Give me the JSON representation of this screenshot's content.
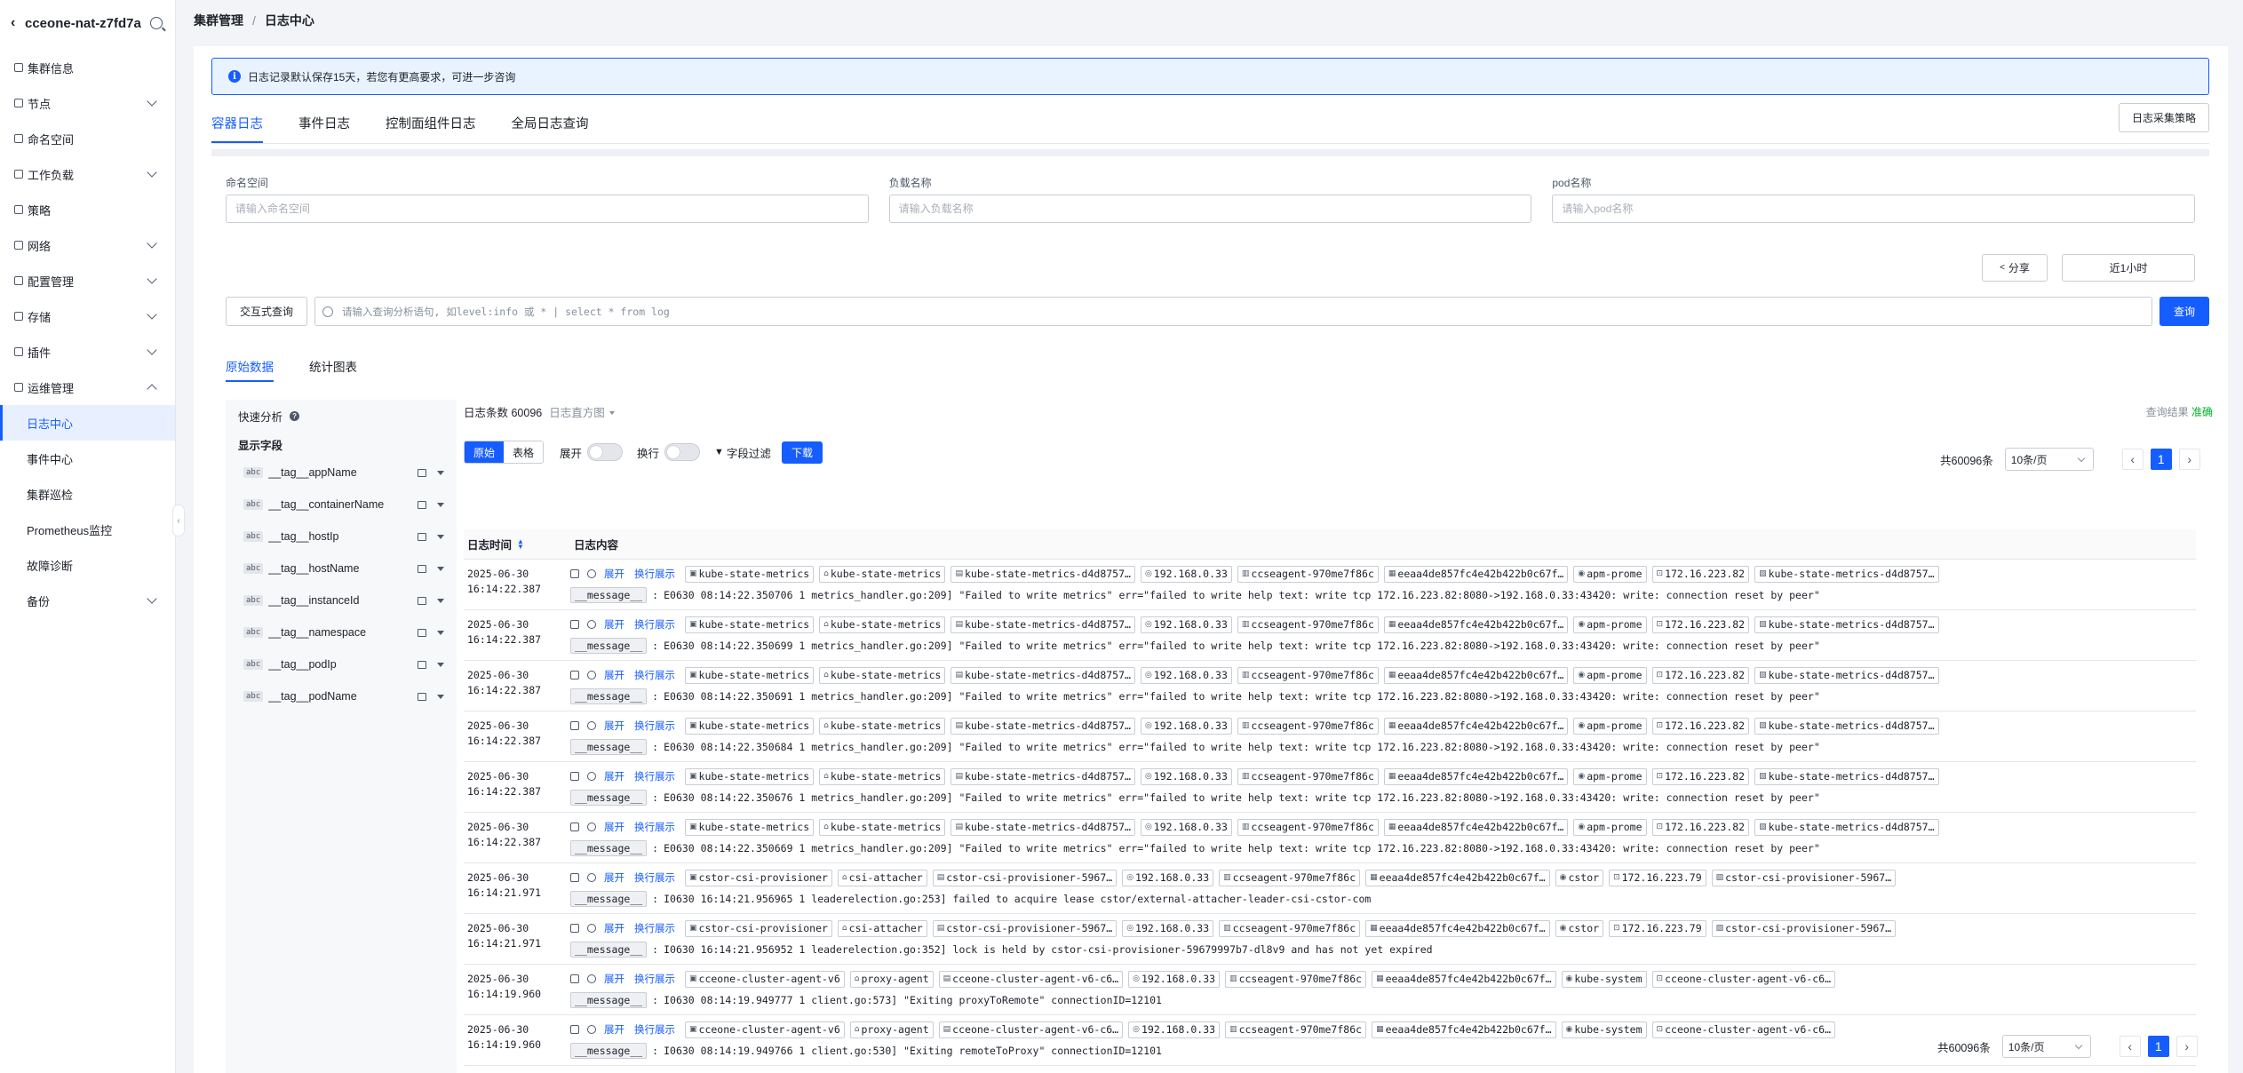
{
  "sidebar": {
    "title": "cceone-nat-z7fd7a",
    "items": [
      {
        "label": "集群信息",
        "chevron": false
      },
      {
        "label": "节点",
        "chevron": true
      },
      {
        "label": "命名空间",
        "chevron": false
      },
      {
        "label": "工作负载",
        "chevron": true
      },
      {
        "label": "策略",
        "chevron": false
      },
      {
        "label": "网络",
        "chevron": true
      },
      {
        "label": "配置管理",
        "chevron": true
      },
      {
        "label": "存储",
        "chevron": true
      },
      {
        "label": "插件",
        "chevron": true
      },
      {
        "label": "运维管理",
        "chevron": true
      }
    ],
    "sub_items": [
      "日志中心",
      "事件中心",
      "集群巡检",
      "Prometheus监控",
      "故障诊断"
    ],
    "last_item": "备份"
  },
  "breadcrumb": {
    "parent": "集群管理",
    "separator": "/",
    "current": "日志中心"
  },
  "notice": {
    "text": "日志记录默认保存15天，若您有更高要求，可进一步咨询"
  },
  "tabs": [
    "容器日志",
    "事件日志",
    "控制面组件日志",
    "全局日志查询"
  ],
  "policy_button": "日志采集策略",
  "filters": [
    {
      "label": "命名空间",
      "placeholder": "请输入命名空间"
    },
    {
      "label": "负载名称",
      "placeholder": "请输入负载名称"
    },
    {
      "label": "pod名称",
      "placeholder": "请输入pod名称"
    }
  ],
  "share_button": "分享",
  "time_button": "近1小时",
  "interactive_button": "交互式查询",
  "query": {
    "placeholder": "请输入查询分析语句, 如level:info 或 * | select * from log",
    "button": "查询"
  },
  "sub_tabs": [
    "原始数据",
    "统计图表"
  ],
  "fields_panel": {
    "quick_analysis": "快速分析",
    "help_icon": "?",
    "display_fields": "显示字段",
    "type_badge": "abc",
    "fields": [
      "__tag__appName",
      "__tag__containerName",
      "__tag__hostIp",
      "__tag__hostName",
      "__tag__instanceId",
      "__tag__namespace",
      "__tag__podIp",
      "__tag__podName"
    ]
  },
  "results": {
    "count_label": "日志条数 60096",
    "histogram": "日志直方图",
    "status_label": "查询结果",
    "status_value": "准确",
    "view_modes": [
      "原始",
      "表格"
    ],
    "expand_label": "展开",
    "wrap_label": "换行",
    "field_filter": "字段过滤",
    "download": "下载",
    "col_time": "日志时间",
    "col_content": "日志内容",
    "row_expand": "展开",
    "row_wrap": "换行展示",
    "message_key": "__message__",
    "key_separator": ":",
    "rows": [
      {
        "date": "2025-06-30",
        "time": "16:14:22.387",
        "tags": [
          "kube-state-metrics",
          "kube-state-metrics",
          "kube-state-metrics-d4d8757…",
          "192.168.0.33",
          "ccseagent-970me7f86c",
          "eeaa4de857fc4e42b422b0c67f…",
          "apm-prome",
          "172.16.223.82",
          "kube-state-metrics-d4d8757…"
        ],
        "message": "E0630 08:14:22.350706       1 metrics_handler.go:209] \"Failed to write metrics\" err=\"failed to write help text: write tcp 172.16.223.82:8080->192.168.0.33:43420: write: connection reset by peer\""
      },
      {
        "date": "2025-06-30",
        "time": "16:14:22.387",
        "tags": [
          "kube-state-metrics",
          "kube-state-metrics",
          "kube-state-metrics-d4d8757…",
          "192.168.0.33",
          "ccseagent-970me7f86c",
          "eeaa4de857fc4e42b422b0c67f…",
          "apm-prome",
          "172.16.223.82",
          "kube-state-metrics-d4d8757…"
        ],
        "message": "E0630 08:14:22.350699       1 metrics_handler.go:209] \"Failed to write metrics\" err=\"failed to write help text: write tcp 172.16.223.82:8080->192.168.0.33:43420: write: connection reset by peer\""
      },
      {
        "date": "2025-06-30",
        "time": "16:14:22.387",
        "tags": [
          "kube-state-metrics",
          "kube-state-metrics",
          "kube-state-metrics-d4d8757…",
          "192.168.0.33",
          "ccseagent-970me7f86c",
          "eeaa4de857fc4e42b422b0c67f…",
          "apm-prome",
          "172.16.223.82",
          "kube-state-metrics-d4d8757…"
        ],
        "message": "E0630 08:14:22.350691       1 metrics_handler.go:209] \"Failed to write metrics\" err=\"failed to write help text: write tcp 172.16.223.82:8080->192.168.0.33:43420: write: connection reset by peer\""
      },
      {
        "date": "2025-06-30",
        "time": "16:14:22.387",
        "tags": [
          "kube-state-metrics",
          "kube-state-metrics",
          "kube-state-metrics-d4d8757…",
          "192.168.0.33",
          "ccseagent-970me7f86c",
          "eeaa4de857fc4e42b422b0c67f…",
          "apm-prome",
          "172.16.223.82",
          "kube-state-metrics-d4d8757…"
        ],
        "message": "E0630 08:14:22.350684       1 metrics_handler.go:209] \"Failed to write metrics\" err=\"failed to write help text: write tcp 172.16.223.82:8080->192.168.0.33:43420: write: connection reset by peer\""
      },
      {
        "date": "2025-06-30",
        "time": "16:14:22.387",
        "tags": [
          "kube-state-metrics",
          "kube-state-metrics",
          "kube-state-metrics-d4d8757…",
          "192.168.0.33",
          "ccseagent-970me7f86c",
          "eeaa4de857fc4e42b422b0c67f…",
          "apm-prome",
          "172.16.223.82",
          "kube-state-metrics-d4d8757…"
        ],
        "message": "E0630 08:14:22.350676       1 metrics_handler.go:209] \"Failed to write metrics\" err=\"failed to write help text: write tcp 172.16.223.82:8080->192.168.0.33:43420: write: connection reset by peer\""
      },
      {
        "date": "2025-06-30",
        "time": "16:14:22.387",
        "tags": [
          "kube-state-metrics",
          "kube-state-metrics",
          "kube-state-metrics-d4d8757…",
          "192.168.0.33",
          "ccseagent-970me7f86c",
          "eeaa4de857fc4e42b422b0c67f…",
          "apm-prome",
          "172.16.223.82",
          "kube-state-metrics-d4d8757…"
        ],
        "message": "E0630 08:14:22.350669       1 metrics_handler.go:209] \"Failed to write metrics\" err=\"failed to write help text: write tcp 172.16.223.82:8080->192.168.0.33:43420: write: connection reset by peer\""
      },
      {
        "date": "2025-06-30",
        "time": "16:14:21.971",
        "tags": [
          "cstor-csi-provisioner",
          "csi-attacher",
          "cstor-csi-provisioner-5967…",
          "192.168.0.33",
          "ccseagent-970me7f86c",
          "eeaa4de857fc4e42b422b0c67f…",
          "cstor",
          "172.16.223.79",
          "cstor-csi-provisioner-5967…"
        ],
        "message": "I0630 16:14:21.956965       1 leaderelection.go:253] failed to acquire lease cstor/external-attacher-leader-csi-cstor-com"
      },
      {
        "date": "2025-06-30",
        "time": "16:14:21.971",
        "tags": [
          "cstor-csi-provisioner",
          "csi-attacher",
          "cstor-csi-provisioner-5967…",
          "192.168.0.33",
          "ccseagent-970me7f86c",
          "eeaa4de857fc4e42b422b0c67f…",
          "cstor",
          "172.16.223.79",
          "cstor-csi-provisioner-5967…"
        ],
        "message": "I0630 16:14:21.956952       1 leaderelection.go:352] lock is held by cstor-csi-provisioner-59679997b7-dl8v9 and has not yet expired"
      },
      {
        "date": "2025-06-30",
        "time": "16:14:19.960",
        "tags": [
          "cceone-cluster-agent-v6",
          "proxy-agent",
          "cceone-cluster-agent-v6-c6…",
          "192.168.0.33",
          "ccseagent-970me7f86c",
          "eeaa4de857fc4e42b422b0c67f…",
          "kube-system",
          "cceone-cluster-agent-v6-c6…"
        ],
        "message": "I0630 08:14:19.949777       1 client.go:573] \"Exiting proxyToRemote\" connectionID=12101"
      },
      {
        "date": "2025-06-30",
        "time": "16:14:19.960",
        "tags": [
          "cceone-cluster-agent-v6",
          "proxy-agent",
          "cceone-cluster-agent-v6-c6…",
          "192.168.0.33",
          "ccseagent-970me7f86c",
          "eeaa4de857fc4e42b422b0c67f…",
          "kube-system",
          "cceone-cluster-agent-v6-c6…"
        ],
        "message": "I0630 08:14:19.949766       1 client.go:530] \"Exiting remoteToProxy\" connectionID=12101"
      }
    ]
  },
  "pagination": {
    "total": "共60096条",
    "page_size": "10条/页",
    "current_page": "1",
    "prev": "‹",
    "next": "›"
  },
  "colors": {
    "accent": "#165dff",
    "success": "#00b42a",
    "notice_bg": "#e8f3ff"
  }
}
